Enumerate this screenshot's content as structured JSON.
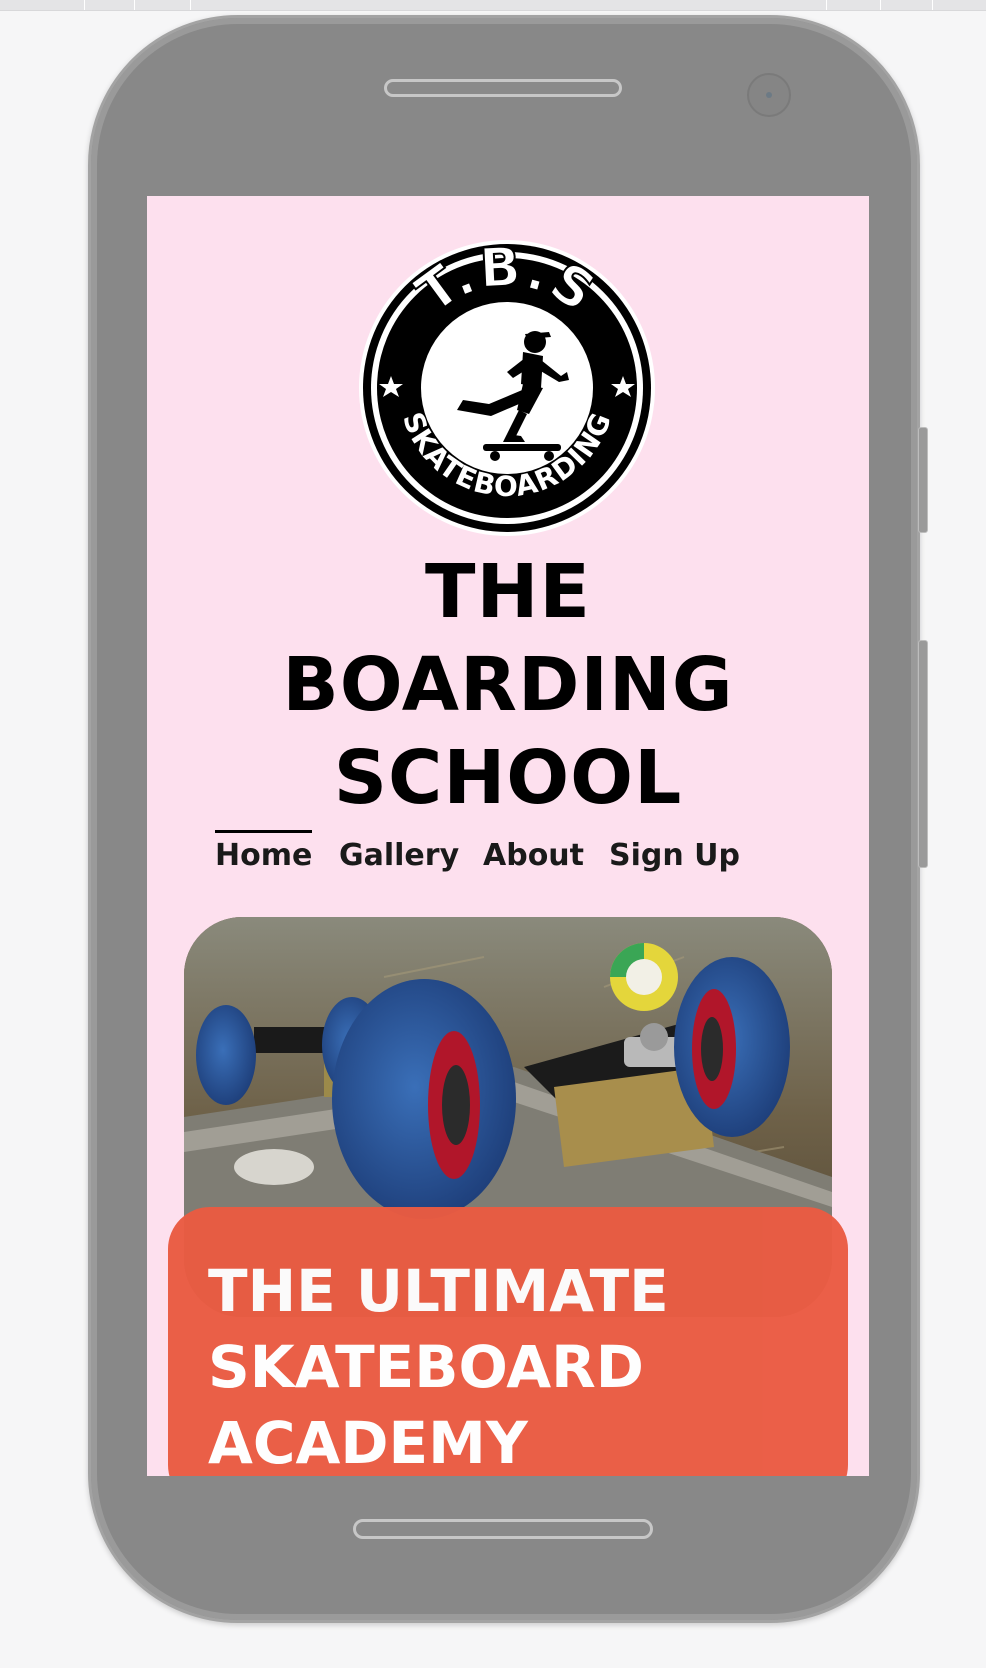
{
  "logo": {
    "initials": "T.B.S",
    "ring_text": "SKATEBOARDING",
    "icon": "skateboarder-icon"
  },
  "site": {
    "title_lines": [
      "THE",
      "BOARDING",
      "SCHOOL"
    ]
  },
  "nav": {
    "items": [
      {
        "label": "Home",
        "active": true
      },
      {
        "label": "Gallery",
        "active": false
      },
      {
        "label": "About",
        "active": false
      },
      {
        "label": "Sign Up",
        "active": false
      }
    ]
  },
  "hero": {
    "image": "skateboard-wheels-photo",
    "heading_lines": [
      "THE ULTIMATE",
      "SKATEBOARD",
      "ACADEMY"
    ]
  },
  "colors": {
    "page_bg": "#fde0ee",
    "accent": "#ea5b42",
    "phone_frame": "#888888",
    "text": "#000000",
    "hero_text": "#ffffff"
  }
}
